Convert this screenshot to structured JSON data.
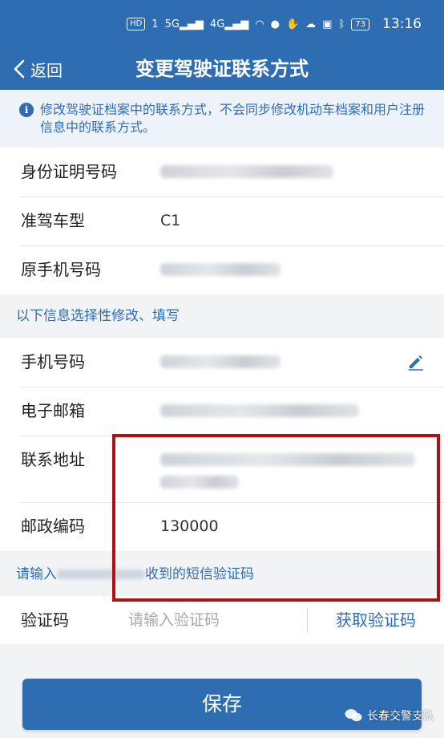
{
  "status_bar": {
    "hd_badge": "HD",
    "sim_slot": "1",
    "net_5g": "5G",
    "net_4g": "4G",
    "battery": "73",
    "time": "13:16"
  },
  "header": {
    "back_label": "返回",
    "title": "变更驾驶证联系方式"
  },
  "notice": {
    "text": "修改驾驶证档案中的联系方式，不会同步修改机动车档案和用户注册信息中的联系方式。"
  },
  "info_fields": [
    {
      "label": "身份证明号码",
      "value": ""
    },
    {
      "label": "准驾车型",
      "value": "C1"
    },
    {
      "label": "原手机号码",
      "value": ""
    }
  ],
  "optional_section_label": "以下信息选择性修改、填写",
  "optional_fields": [
    {
      "label": "手机号码"
    },
    {
      "label": "电子邮箱"
    },
    {
      "label": "联系地址"
    },
    {
      "label": "邮政编码",
      "value": "130000"
    }
  ],
  "sms_prompt": {
    "prefix": "请输入",
    "suffix": "收到的短信验证码"
  },
  "verify": {
    "label": "验证码",
    "placeholder": "请输入验证码",
    "get_code_label": "获取验证码"
  },
  "save_label": "保存",
  "watermark": "长春交警支队",
  "colors": {
    "primary": "#2f6db3",
    "highlight": "#b00f16",
    "background": "#f2f3f5"
  }
}
